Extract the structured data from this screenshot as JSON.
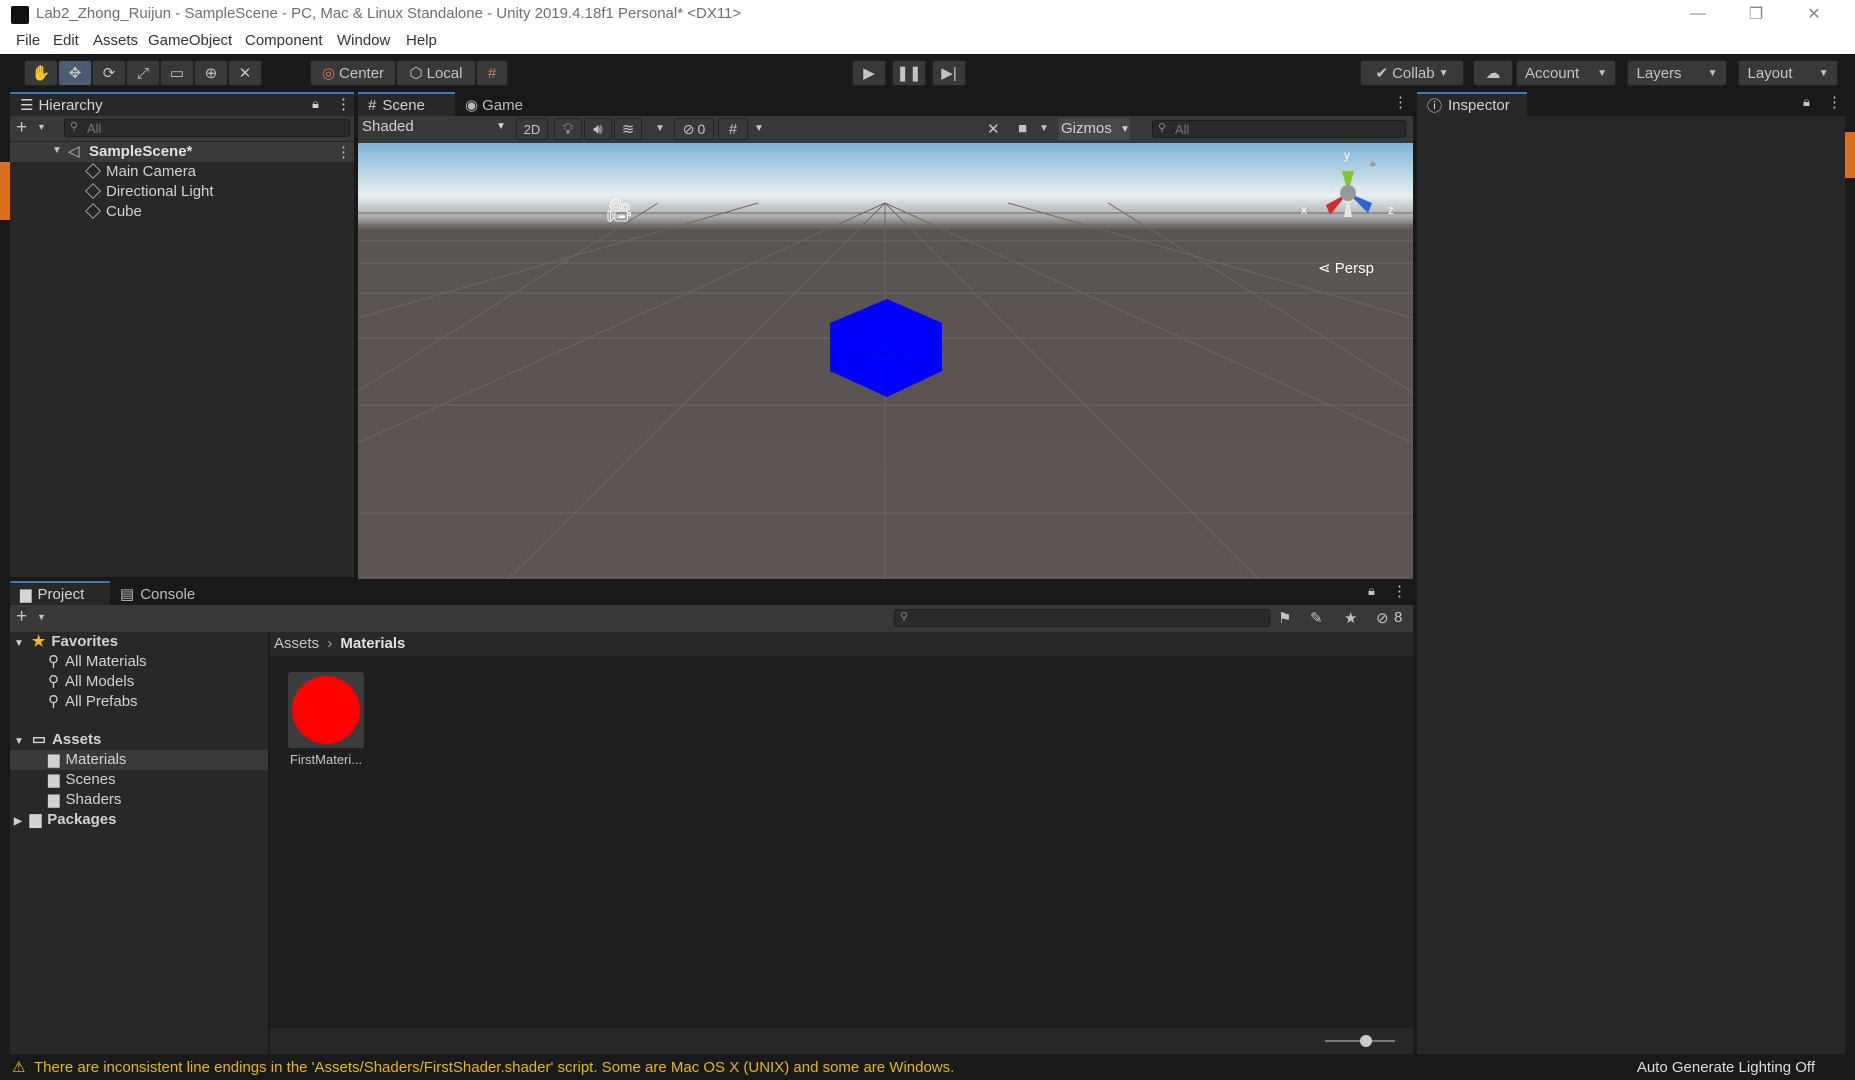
{
  "window": {
    "title": "Lab2_Zhong_Ruijun - SampleScene - PC, Mac & Linux Standalone - Unity 2019.4.18f1 Personal* <DX11>",
    "minimize": "—",
    "restore": "❐",
    "close": "✕"
  },
  "menu": [
    "File",
    "Edit",
    "Assets",
    "GameObject",
    "Component",
    "Window",
    "Help"
  ],
  "toolbar": {
    "pivot": "Center",
    "space": "Local",
    "collab": "Collab",
    "account": "Account",
    "layers": "Layers",
    "layout": "Layout"
  },
  "hierarchy": {
    "tab": "Hierarchy",
    "search_placeholder": "All",
    "scene": "SampleScene*",
    "items": [
      "Main Camera",
      "Directional Light",
      "Cube"
    ]
  },
  "scene_view": {
    "tabs": [
      "Scene",
      "Game"
    ],
    "shading": "Shaded",
    "mode_2d": "2D",
    "hidden_count": "0",
    "gizmos": "Gizmos",
    "search_placeholder": "All",
    "gizmo_axes": {
      "y": "y",
      "x": "x",
      "z": "z"
    },
    "projection": "Persp"
  },
  "inspector": {
    "tab": "Inspector"
  },
  "project": {
    "tabs": [
      "Project",
      "Console"
    ],
    "badge_count": "8",
    "favorites": {
      "label": "Favorites",
      "items": [
        "All Materials",
        "All Models",
        "All Prefabs"
      ]
    },
    "assets": {
      "label": "Assets",
      "items": [
        "Materials",
        "Scenes",
        "Shaders"
      ]
    },
    "packages": "Packages",
    "breadcrumb": [
      "Assets",
      "Materials"
    ],
    "files": [
      {
        "name": "FirstMateri...",
        "color": "#ff0000"
      }
    ]
  },
  "status": {
    "warning": "There are inconsistent line endings in the 'Assets/Shaders/FirstShader.shader' script. Some are Mac OS X (UNIX) and some are Windows.",
    "right": "Auto Generate Lighting Off"
  },
  "colors": {
    "accent": "#3a79bb",
    "cube": "#0000ff",
    "material": "#ff0000",
    "warning": "#f0c000"
  }
}
